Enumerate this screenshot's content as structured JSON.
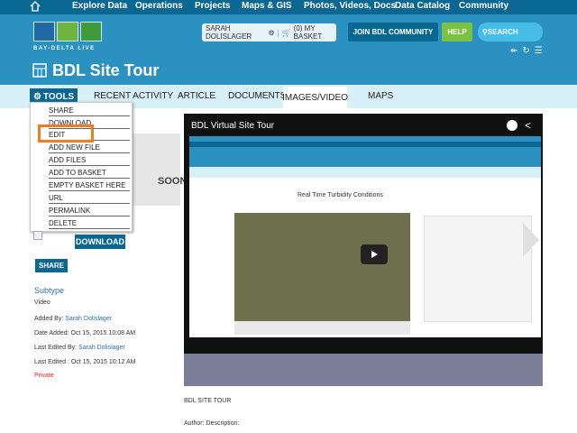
{
  "nav": {
    "items": [
      "Explore Data",
      "Operations",
      "Projects",
      "Maps & GIS",
      "Photos, Videos, Docs",
      "Data Catalog",
      "Community"
    ]
  },
  "banner": {
    "logo_text": "BAY-DELTA LIVE",
    "user_label": "SARAH DOLISLAGER",
    "basket_label": "(0) MY BASKET",
    "join_label": "JOIN BDL COMMUNITY",
    "help_label": "HELP",
    "search_label": "SEARCH"
  },
  "page": {
    "title": "BDL Site Tour"
  },
  "tabs": {
    "tools": "TOOLS",
    "recent": "RECENT ACTIVITY",
    "article": "ARTICLE",
    "documents": "DOCUMENTS",
    "images": "IMAGES/VIDEO",
    "maps": "MAPS"
  },
  "menu": {
    "items": [
      "SHARE",
      "DOWNLOAD",
      "EDIT",
      "ADD NEW FILE",
      "ADD FILES",
      "ADD TO BASKET",
      "EMPTY BASKET HERE",
      "URL",
      "PERMALINK",
      "DELETE"
    ]
  },
  "sidebar": {
    "thumb_text": "SOON",
    "download_label": "DOWNLOAD",
    "share_label": "SHARE",
    "subtype_label": "Subtype",
    "subtype_value": "Video",
    "added_by_label": "Added By:",
    "added_by_value": "Sarah Dolislager",
    "date_added": "Date Added: Oct 15, 2015 10:08 AM",
    "last_edited_by_label": "Last Edited By:",
    "last_edited_by_value": "Sarah Dolislager",
    "last_edited": "Last Edited : Oct 15, 2015 10:12 AM",
    "private_label": "Private"
  },
  "player": {
    "title": "BDL Virtual Site Tour",
    "inner_heading": "Real Time Turbidity Conditions"
  },
  "content": {
    "caption": "BDL SITE TOUR",
    "author": "Author: Description:"
  }
}
